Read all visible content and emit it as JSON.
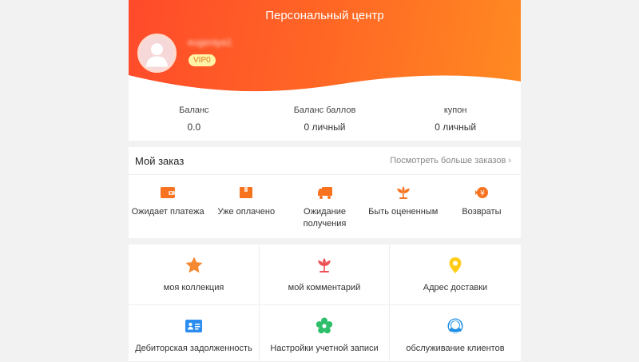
{
  "header": {
    "title": "Персональный центр",
    "username": "eugeniya1",
    "vip_badge": "VIP0"
  },
  "stats": [
    {
      "label": "Баланс",
      "value": "0.0"
    },
    {
      "label": "Баланс баллов",
      "value": "0 личный"
    },
    {
      "label": "купон",
      "value": "0 личный"
    }
  ],
  "orders": {
    "title": "Мой заказ",
    "more": "Посмотреть больше заказов",
    "items": [
      {
        "label": "Ожидает платежа",
        "icon": "wallet-icon"
      },
      {
        "label": "Уже оплачено",
        "icon": "package-icon"
      },
      {
        "label": "Ожидание получения",
        "icon": "truck-icon"
      },
      {
        "label": "Быть оцененным",
        "icon": "flower-icon"
      },
      {
        "label": "Возвраты",
        "icon": "refund-icon"
      }
    ]
  },
  "services": [
    {
      "label": "моя коллекция",
      "icon": "star-icon"
    },
    {
      "label": "мой комментарий",
      "icon": "lotus-icon"
    },
    {
      "label": "Адрес доставки",
      "icon": "location-pin-icon"
    },
    {
      "label": "Дебиторская задолженность",
      "icon": "id-card-icon"
    },
    {
      "label": "Настройки учетной записи",
      "icon": "settings-flower-icon"
    },
    {
      "label": "обслуживание клиентов",
      "icon": "headset-icon"
    }
  ],
  "colors": {
    "header_start": "#ff4a2a",
    "header_end": "#ff8a22",
    "order_icon": "#f7731f",
    "star": "#f58a33",
    "lotus": "#ef5055",
    "pin": "#ffcc1a",
    "idcard": "#2b8df0",
    "settings": "#2fbf6b",
    "headset": "#1e8fe6"
  }
}
